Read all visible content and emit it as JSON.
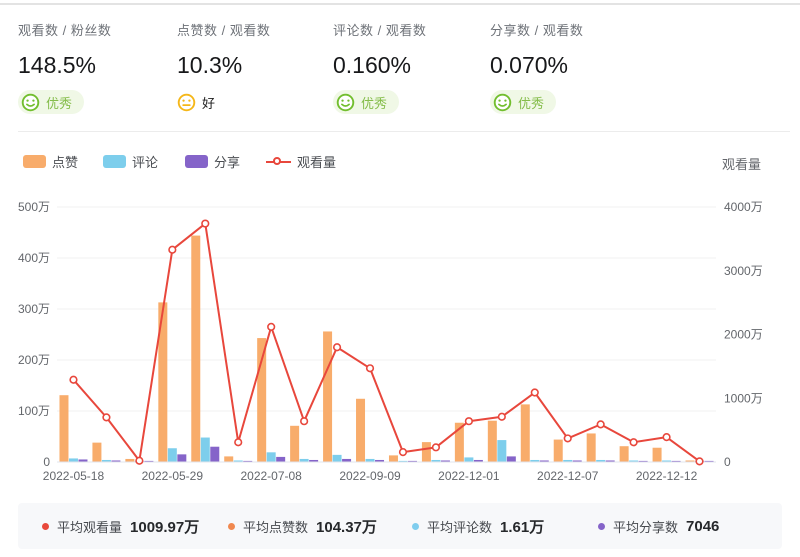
{
  "stats": {
    "cards": [
      {
        "label": "观看数 / 粉丝数",
        "value": "148.5%",
        "rating": "优秀",
        "level": "excellent"
      },
      {
        "label": "点赞数 / 观看数",
        "value": "10.3%",
        "rating": "好",
        "level": "good"
      },
      {
        "label": "评论数 / 观看数",
        "value": "0.160%",
        "rating": "优秀",
        "level": "excellent"
      },
      {
        "label": "分享数 / 观看数",
        "value": "0.070%",
        "rating": "优秀",
        "level": "excellent"
      }
    ]
  },
  "legend": {
    "items": [
      {
        "label": "点赞",
        "type": "bar",
        "color": "#f8ac6b"
      },
      {
        "label": "评论",
        "type": "bar",
        "color": "#7dceec"
      },
      {
        "label": "分享",
        "type": "bar",
        "color": "#8564c9"
      },
      {
        "label": "观看量",
        "type": "line",
        "color": "#e8473c"
      }
    ]
  },
  "chart_data": {
    "type": "bar+line",
    "n_points": 20,
    "x_tick_labels": [
      {
        "index": 0,
        "label": "2022-05-18"
      },
      {
        "index": 3,
        "label": "2022-05-29"
      },
      {
        "index": 6,
        "label": "2022-07-08"
      },
      {
        "index": 9,
        "label": "2022-09-09"
      },
      {
        "index": 12,
        "label": "2022-12-01"
      },
      {
        "index": 15,
        "label": "2022-12-07"
      },
      {
        "index": 18,
        "label": "2022-12-12"
      }
    ],
    "series": [
      {
        "name": "点赞",
        "type": "bar",
        "axis": "left",
        "color": "#f8ac6b",
        "values": [
          130,
          37,
          5,
          312,
          443,
          10,
          242,
          70,
          255,
          123,
          12,
          38,
          76,
          80,
          112,
          43,
          55,
          30,
          27,
          2
        ]
      },
      {
        "name": "评论",
        "type": "bar",
        "axis": "left",
        "color": "#7dceec",
        "values": [
          6,
          3,
          1,
          26,
          47,
          2,
          18,
          5,
          13,
          5,
          1,
          3,
          8,
          42,
          3,
          3,
          3,
          2,
          2,
          1
        ]
      },
      {
        "name": "分享",
        "type": "bar",
        "axis": "left",
        "color": "#8564c9",
        "values": [
          4,
          2,
          1,
          14,
          29,
          1,
          9,
          3,
          5,
          3,
          1,
          2,
          3,
          10,
          2,
          2,
          2,
          1,
          1,
          1
        ]
      },
      {
        "name": "观看量",
        "type": "line",
        "axis": "right",
        "color": "#e8473c",
        "values": [
          1290,
          700,
          20,
          3330,
          3740,
          310,
          2120,
          640,
          1800,
          1470,
          155,
          230,
          640,
          710,
          1090,
          370,
          590,
          310,
          390,
          10
        ]
      }
    ],
    "unit": "万",
    "left_axis": {
      "max": 500,
      "ticks": [
        "0",
        "100万",
        "200万",
        "300万",
        "400万",
        "500万"
      ]
    },
    "right_axis": {
      "title": "观看量",
      "max": 4000,
      "ticks": [
        "0",
        "1000万",
        "2000万",
        "3000万",
        "4000万"
      ]
    },
    "grid": true,
    "legend_position": "top-left"
  },
  "summary": {
    "items": [
      {
        "label": "平均观看量",
        "value": "1009.97万",
        "color": "#e8493b"
      },
      {
        "label": "平均点赞数",
        "value": "104.37万",
        "color": "#f0884f"
      },
      {
        "label": "平均评论数",
        "value": "1.61万",
        "color": "#7fcdee"
      },
      {
        "label": "平均分享数",
        "value": "7046",
        "color": "#8564c9"
      }
    ]
  },
  "colors": {
    "excellent_green": "#72be2e",
    "good_yellow": "#f5b719",
    "grid_line": "#f0f0f0",
    "axis_line": "#e2e5ec",
    "tick_text": "#63666b"
  }
}
